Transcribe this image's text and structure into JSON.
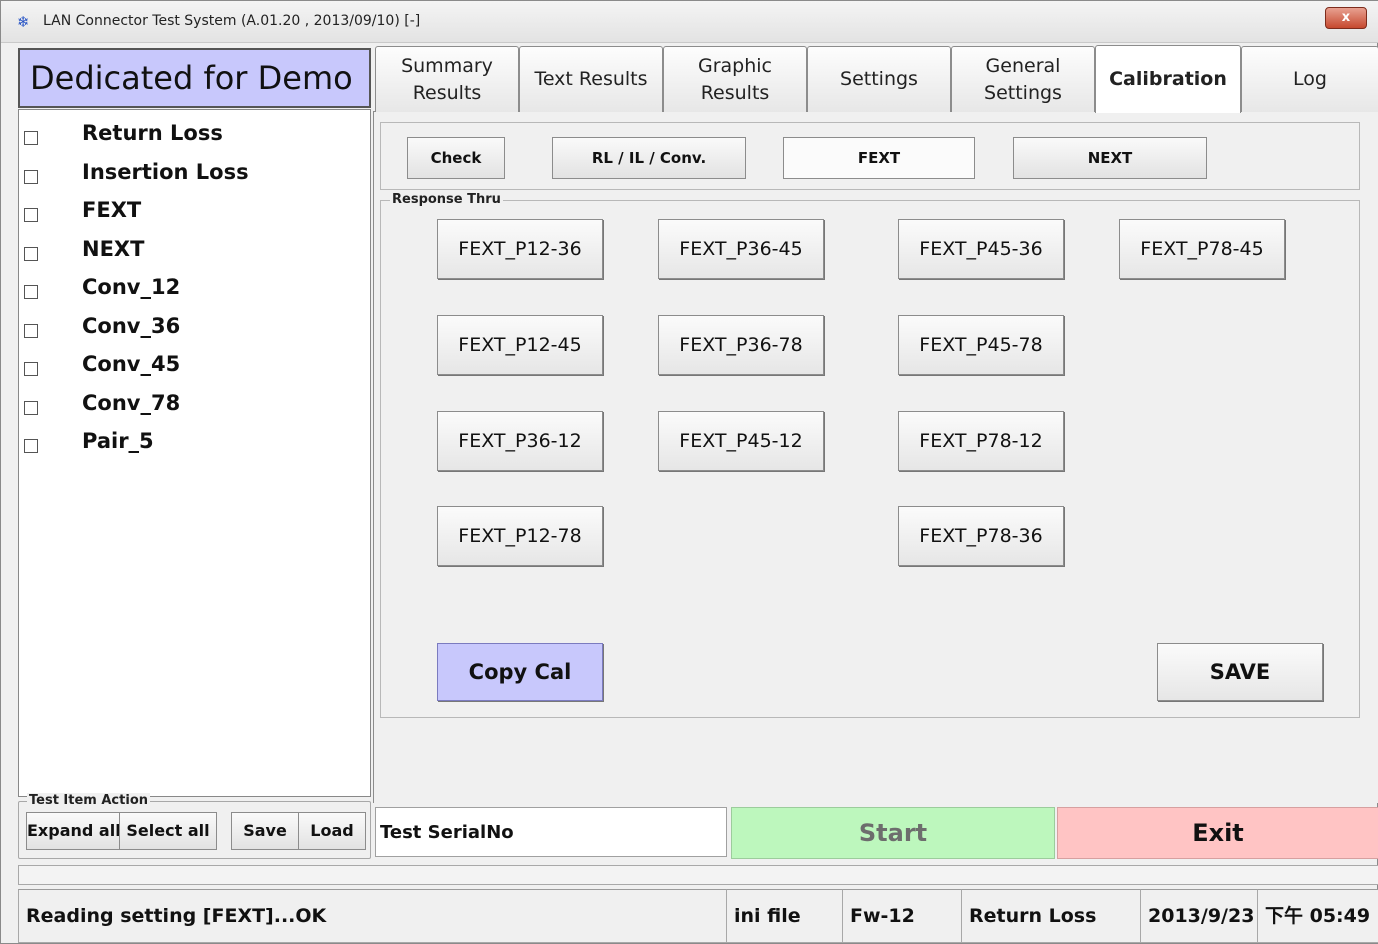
{
  "window": {
    "title": "LAN Connector Test System  (A.01.20 , 2013/09/10)  [-]",
    "close_label": "x",
    "app_icon": "app-logo-icon"
  },
  "sidebar": {
    "header": "Dedicated for Demo",
    "items": [
      {
        "label": "Return Loss",
        "checked": false
      },
      {
        "label": "Insertion Loss",
        "checked": false
      },
      {
        "label": "FEXT",
        "checked": false
      },
      {
        "label": "NEXT",
        "checked": false
      },
      {
        "label": "Conv_12",
        "checked": false
      },
      {
        "label": "Conv_36",
        "checked": false
      },
      {
        "label": "Conv_45",
        "checked": false
      },
      {
        "label": "Conv_78",
        "checked": false
      },
      {
        "label": "Pair_5",
        "checked": false
      }
    ],
    "action_group": {
      "legend": "Test Item Action",
      "buttons": [
        "Expand all",
        "Select all",
        "Save",
        "Load"
      ]
    }
  },
  "tabs": [
    {
      "label": "Summary\nResults",
      "active": false
    },
    {
      "label": "Text Results",
      "active": false
    },
    {
      "label": "Graphic\nResults",
      "active": false
    },
    {
      "label": "Settings",
      "active": false
    },
    {
      "label": "General\nSettings",
      "active": false
    },
    {
      "label": "Calibration",
      "active": true
    },
    {
      "label": "Log",
      "active": false
    }
  ],
  "calibration": {
    "subtabs": [
      {
        "label": "Check",
        "active": false
      },
      {
        "label": "RL / IL / Conv.",
        "active": false
      },
      {
        "label": "FEXT",
        "active": true
      },
      {
        "label": "NEXT",
        "active": false
      }
    ],
    "group_label": "Response Thru",
    "buttons": [
      "FEXT_P12-36",
      "FEXT_P36-45",
      "FEXT_P45-36",
      "FEXT_P78-45",
      "FEXT_P12-45",
      "FEXT_P36-78",
      "FEXT_P45-78",
      "FEXT_P36-12",
      "FEXT_P45-12",
      "FEXT_P78-12",
      "FEXT_P12-78",
      "FEXT_P78-36"
    ],
    "copy_cal_label": "Copy Cal",
    "save_label": "SAVE"
  },
  "controls": {
    "serial_value": "Test SerialNo",
    "start_label": "Start",
    "exit_label": "Exit"
  },
  "status": {
    "message": "Reading setting [FEXT]...OK",
    "config": "ini file",
    "firmware": "Fw-12",
    "current_test": "Return Loss",
    "date": "2013/9/23",
    "time": "下午 05:49"
  },
  "colors": {
    "header_bg": "#c8c8fc",
    "copy_cal_bg": "#c8c8fc",
    "start_bg": "#bdf7bd",
    "exit_bg": "#ffc4c4"
  }
}
